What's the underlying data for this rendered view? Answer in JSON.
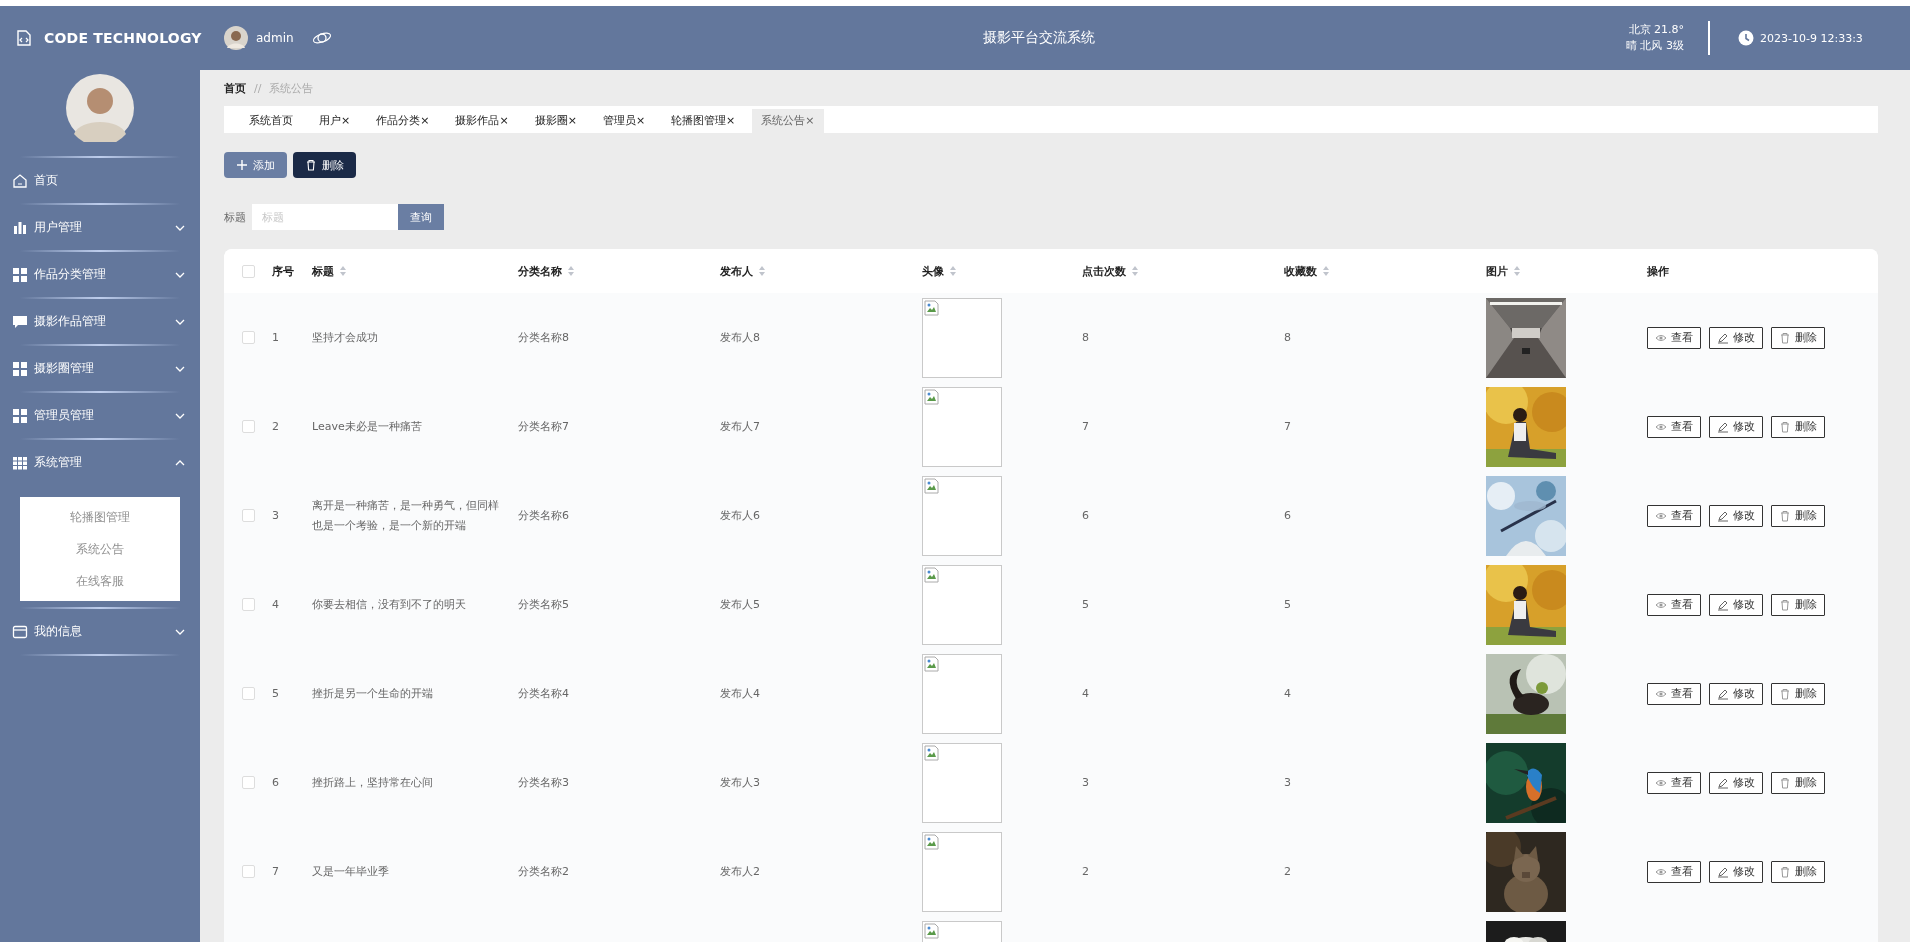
{
  "header": {
    "brand": "CODE TECHNOLOGY",
    "user": "admin",
    "title": "摄影平台交流系统",
    "weather": [
      "北京  21.8°",
      "晴  北风  3级"
    ],
    "datetime": "2023-10-9 12:33:3"
  },
  "sidebar": {
    "items": [
      {
        "label": "首页",
        "kind": "link"
      },
      {
        "label": "用户管理",
        "kind": "group",
        "expanded": false
      },
      {
        "label": "作品分类管理",
        "kind": "group",
        "expanded": false
      },
      {
        "label": "摄影作品管理",
        "kind": "group",
        "expanded": false
      },
      {
        "label": "摄影圈管理",
        "kind": "group",
        "expanded": false
      },
      {
        "label": "管理员管理",
        "kind": "group",
        "expanded": false
      },
      {
        "label": "系统管理",
        "kind": "group",
        "expanded": true,
        "children": [
          {
            "label": "轮播图管理"
          },
          {
            "label": "系统公告"
          },
          {
            "label": "在线客服"
          }
        ]
      },
      {
        "label": "我的信息",
        "kind": "group",
        "expanded": false
      }
    ]
  },
  "breadcrumb": [
    "首页",
    "//",
    "系统公告"
  ],
  "tabs": [
    {
      "label": "系统首页",
      "selected": false
    },
    {
      "label": "用户",
      "close": "×",
      "selected": false
    },
    {
      "label": "作品分类",
      "close": "×",
      "selected": false
    },
    {
      "label": "摄影作品",
      "close": "×",
      "selected": false
    },
    {
      "label": "摄影圈",
      "close": "×",
      "selected": false
    },
    {
      "label": "管理员",
      "close": "×",
      "selected": false
    },
    {
      "label": "轮播图管理",
      "close": "×",
      "selected": false
    },
    {
      "label": "系统公告",
      "close": "×",
      "selected": true
    }
  ],
  "toolbar": {
    "add": "添加",
    "delete": "删除"
  },
  "search": {
    "label": "标题",
    "placeholder": "标题",
    "button": "查询"
  },
  "table": {
    "select_all": {
      "checked": false
    },
    "columns": [
      {
        "label": "序号",
        "sortable": false
      },
      {
        "label": "标题",
        "sortable": true
      },
      {
        "label": "分类名称",
        "sortable": true
      },
      {
        "label": "发布人",
        "sortable": true
      },
      {
        "label": "头像",
        "sortable": true
      },
      {
        "label": "点击次数",
        "sortable": true
      },
      {
        "label": "收藏数",
        "sortable": true
      },
      {
        "label": "图片",
        "sortable": true
      },
      {
        "label": "操作",
        "sortable": false
      }
    ],
    "rows": [
      {
        "checked": false,
        "cells": [
          "1",
          "坚持才会成功",
          "分类名称8",
          "发布人8",
          "8",
          "8"
        ],
        "actions": [
          "查看",
          "修改",
          "删除"
        ]
      },
      {
        "checked": false,
        "cells": [
          "2",
          "Leave未必是一种痛苦",
          "分类名称7",
          "发布人7",
          "7",
          "7"
        ],
        "actions": [
          "查看",
          "修改",
          "删除"
        ]
      },
      {
        "checked": false,
        "cells": [
          "3",
          "离开是一种痛苦，是一种勇气，但同样也是一个考验，是一个新的开端",
          "分类名称6",
          "发布人6",
          "6",
          "6"
        ],
        "actions": [
          "查看",
          "修改",
          "删除"
        ]
      },
      {
        "checked": false,
        "cells": [
          "4",
          "你要去相信，没有到不了的明天",
          "分类名称5",
          "发布人5",
          "5",
          "5"
        ],
        "actions": [
          "查看",
          "修改",
          "删除"
        ]
      },
      {
        "checked": false,
        "cells": [
          "5",
          "挫折是另一个生命的开端",
          "分类名称4",
          "发布人4",
          "4",
          "4"
        ],
        "actions": [
          "查看",
          "修改",
          "删除"
        ]
      },
      {
        "checked": false,
        "cells": [
          "6",
          "挫折路上，坚持常在心间",
          "分类名称3",
          "发布人3",
          "3",
          "3"
        ],
        "actions": [
          "查看",
          "修改",
          "删除"
        ]
      },
      {
        "checked": false,
        "cells": [
          "7",
          "又是一年毕业季",
          "分类名称2",
          "发布人2",
          "2",
          "2"
        ],
        "actions": [
          "查看",
          "修改",
          "删除"
        ]
      },
      {
        "partial": true
      }
    ]
  }
}
